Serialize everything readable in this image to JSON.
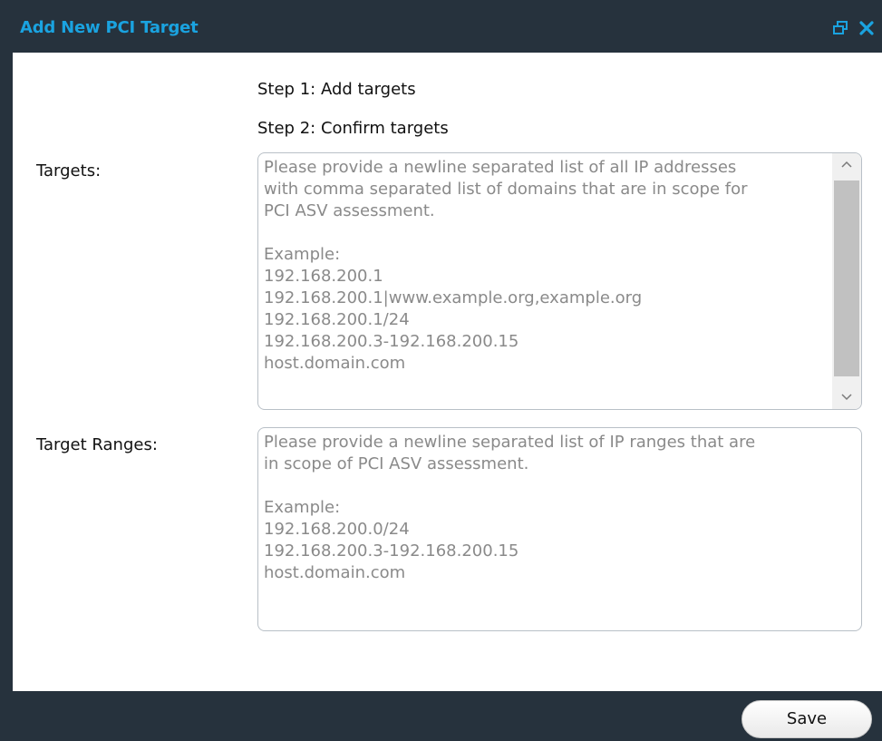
{
  "dialog": {
    "title": "Add New PCI Target",
    "title_color": "#1aa3e0",
    "chrome_color": "#26323d",
    "restore_icon": "restore-window-icon",
    "close_icon": "close-icon"
  },
  "steps": {
    "step1": "Step 1: Add targets",
    "step2": "Step 2: Confirm targets"
  },
  "form": {
    "targets": {
      "label": "Targets:",
      "value": "",
      "placeholder": "Please provide a newline separated list of all IP addresses\nwith comma separated list of domains that are in scope for\nPCI ASV assessment.\n\nExample:\n192.168.200.1\n192.168.200.1|www.example.org,example.org\n192.168.200.1/24\n192.168.200.3-192.168.200.15\nhost.domain.com"
    },
    "target_ranges": {
      "label": "Target Ranges:",
      "value": "",
      "placeholder": "Please provide a newline separated list of IP ranges that are\nin scope of PCI ASV assessment.\n\nExample:\n192.168.200.0/24\n192.168.200.3-192.168.200.15\nhost.domain.com"
    }
  },
  "footer": {
    "save_label": "Save"
  }
}
